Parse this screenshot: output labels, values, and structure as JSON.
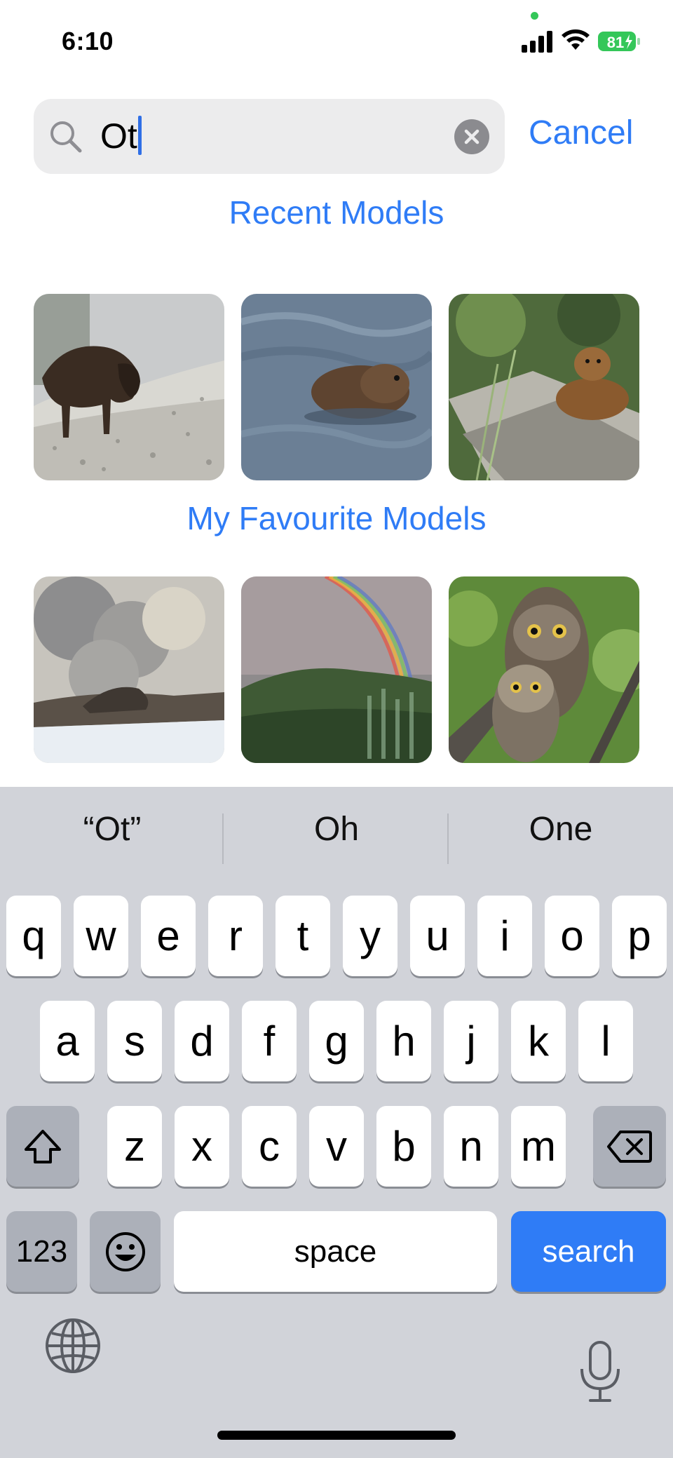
{
  "status_bar": {
    "time": "6:10",
    "battery": "81"
  },
  "search": {
    "value": "Ot",
    "cancel_label": "Cancel"
  },
  "sections": {
    "recent_title": "Recent Models",
    "favourite_title": "My Favourite Models"
  },
  "recent_models": [
    {
      "subject": "bison"
    },
    {
      "subject": "otter"
    },
    {
      "subject": "marmot"
    }
  ],
  "favourite_models": [
    {
      "subject": "geyser"
    },
    {
      "subject": "rainbow"
    },
    {
      "subject": "owls"
    }
  ],
  "keyboard": {
    "suggestions": [
      "“Ot”",
      "Oh",
      "One"
    ],
    "row1": [
      "q",
      "w",
      "e",
      "r",
      "t",
      "y",
      "u",
      "i",
      "o",
      "p"
    ],
    "row2": [
      "a",
      "s",
      "d",
      "f",
      "g",
      "h",
      "j",
      "k",
      "l"
    ],
    "row3": [
      "z",
      "x",
      "c",
      "v",
      "b",
      "n",
      "m"
    ],
    "numbers_label": "123",
    "space_label": "space",
    "search_label": "search"
  },
  "colors": {
    "accent": "#2f7cf6",
    "keyboard_bg": "#d1d3d9",
    "battery_green": "#34c759"
  }
}
